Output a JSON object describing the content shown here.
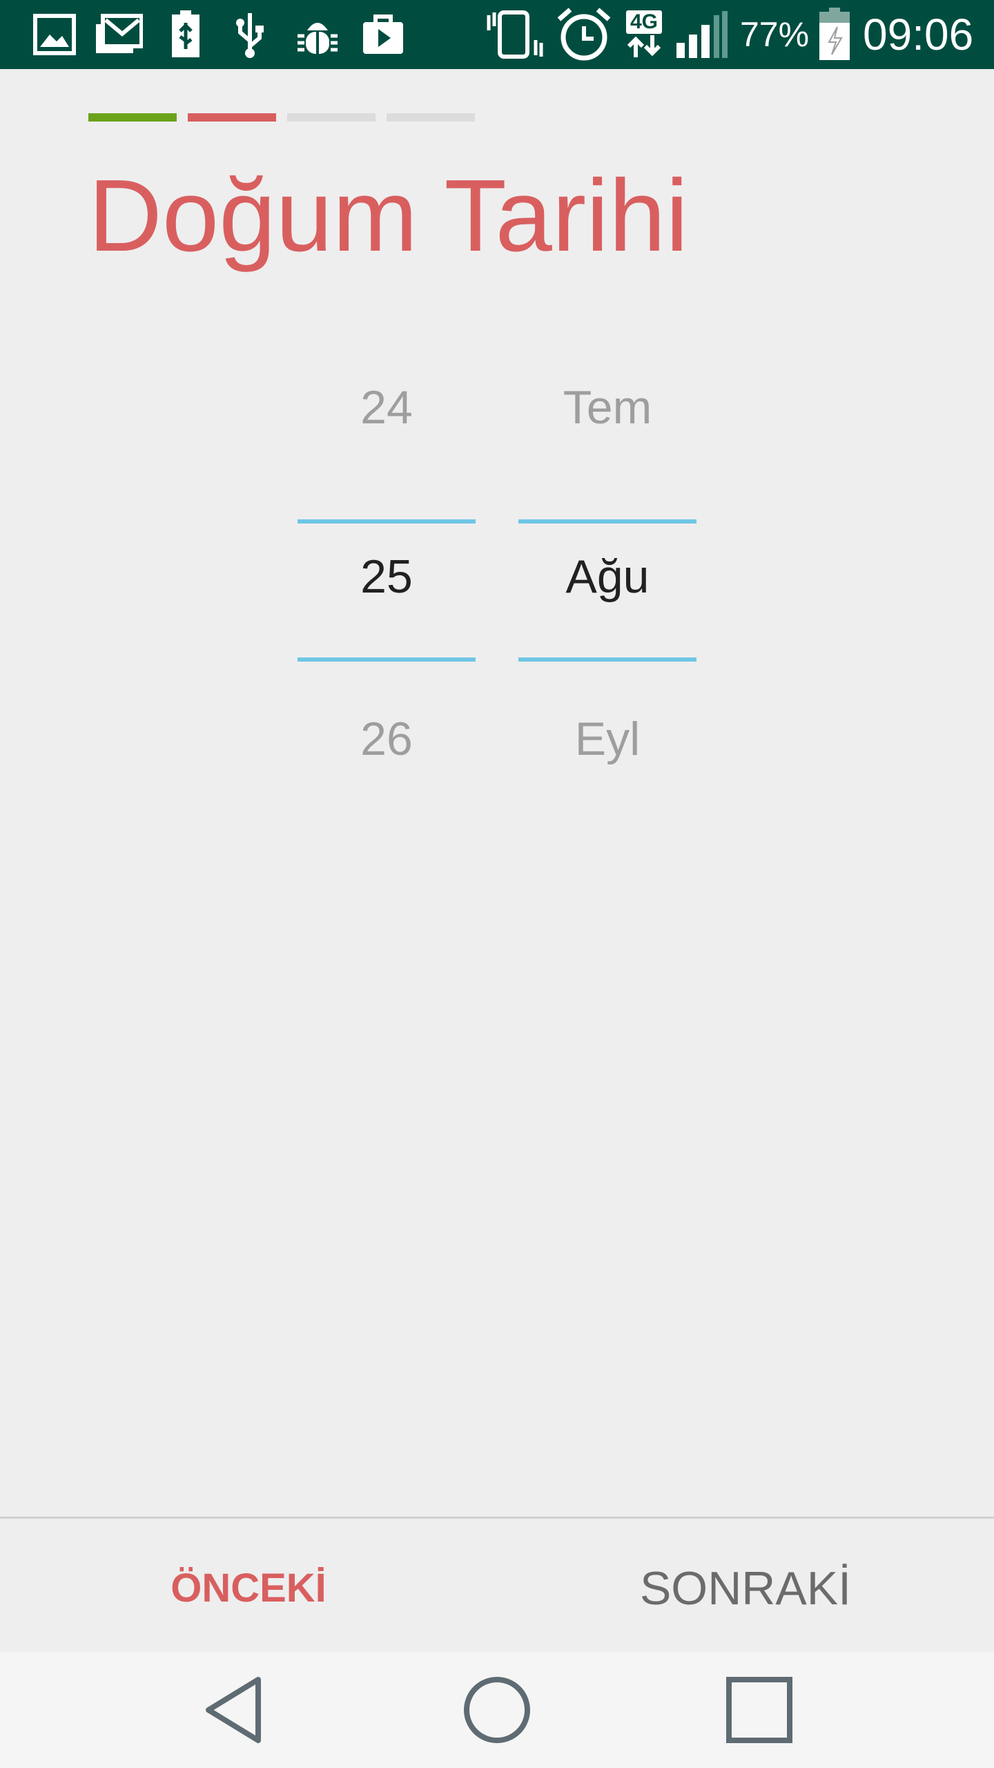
{
  "status_bar": {
    "background": "#004d40",
    "left_icons": [
      "gallery-icon",
      "gmail-icon",
      "battery-usb-icon",
      "usb-icon",
      "android-debug-icon",
      "play-store-icon"
    ],
    "right_icons": [
      "vibrate-icon",
      "alarm-icon",
      "network-4g-icon",
      "signal-icon"
    ],
    "network_label": "4G",
    "battery_percent": "77%",
    "time": "09:06"
  },
  "progress": {
    "segments": [
      {
        "state": "done",
        "color": "#6aa31b"
      },
      {
        "state": "current",
        "color": "#d95f5f"
      },
      {
        "state": "pending",
        "color": "#dcdcdc"
      },
      {
        "state": "pending",
        "color": "#dcdcdc"
      }
    ]
  },
  "title": "Doğum Tarihi",
  "title_color": "#d95f5f",
  "date_picker": {
    "day": {
      "prev": "24",
      "selected": "25",
      "next": "26"
    },
    "month": {
      "prev": "Tem",
      "selected": "Ağu",
      "next": "Eyl"
    },
    "divider_color": "#6ec6e6"
  },
  "footer": {
    "prev_label": "ÖNCEKİ",
    "prev_color": "#d95f5f",
    "next_label": "SONRAKİ",
    "next_color": "#6b6b6b"
  },
  "nav_bar": {
    "buttons": [
      "back-icon",
      "home-icon",
      "recents-icon"
    ],
    "icon_color": "#5f6b73"
  }
}
